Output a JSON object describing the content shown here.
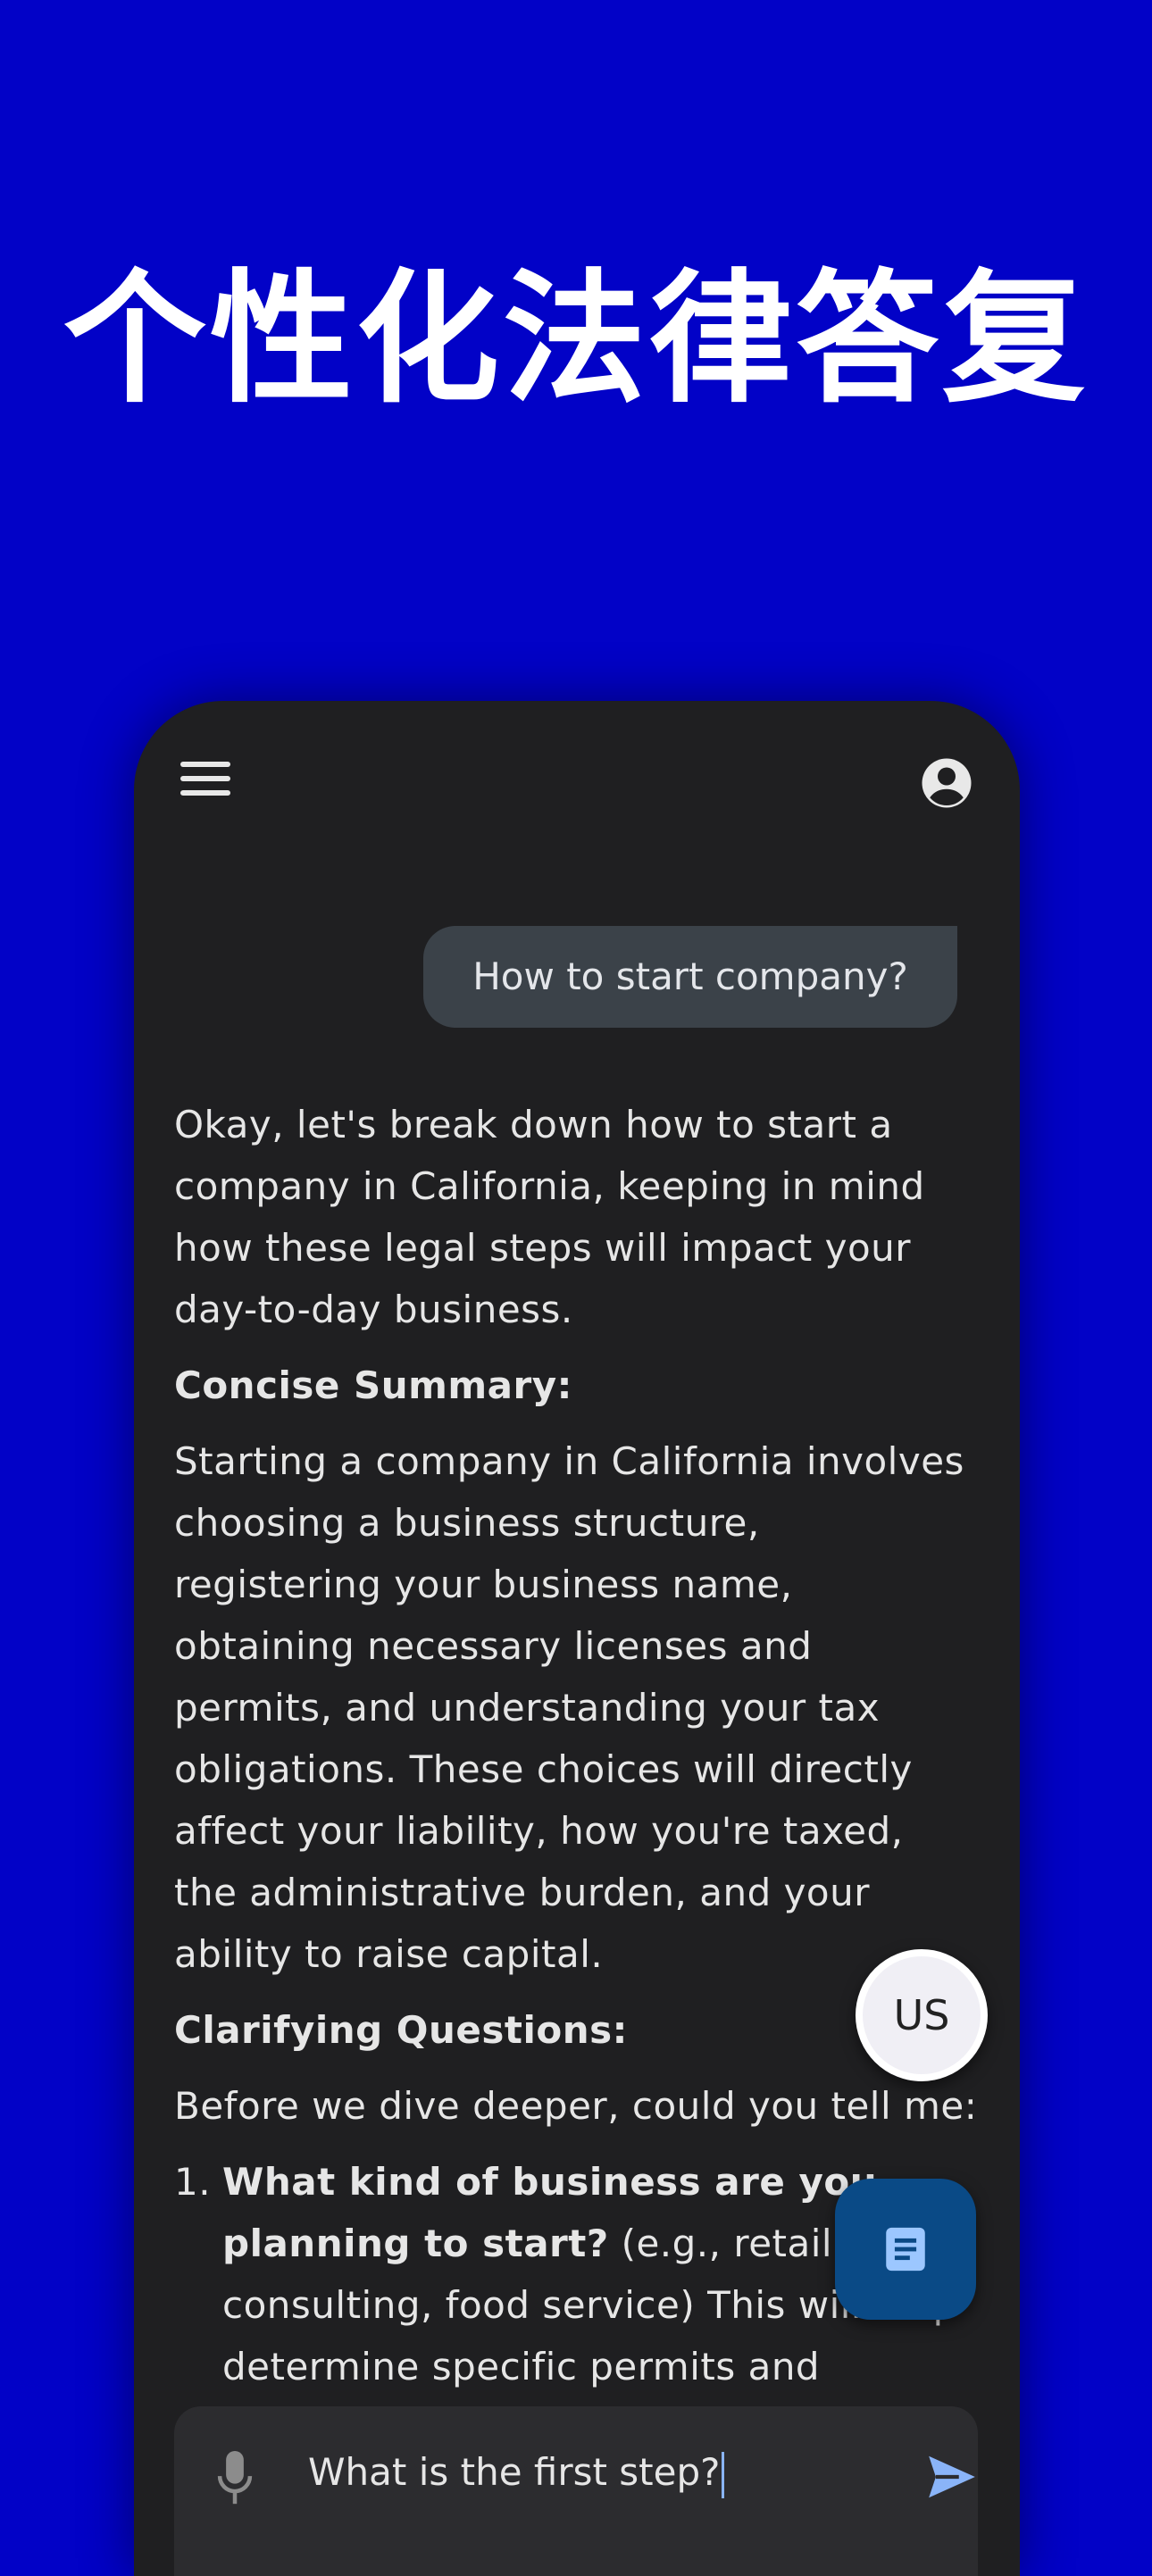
{
  "hero": {
    "title": "个性化法律答复"
  },
  "colors": {
    "background": "#0202c7",
    "phone": "#1f1f21",
    "bubble": "#3b4249",
    "fab": "#0a4a86"
  },
  "toolbar": {
    "menu_icon": "menu-icon",
    "account_icon": "account-icon"
  },
  "chat": {
    "user_message": "How to start company?",
    "reply": {
      "intro": "Okay, let's break down how to start a company in California, keeping in mind how these legal steps will impact your day-to-day business.",
      "summary_heading": "Concise Summary:",
      "summary": "Starting a company in California involves choosing a business structure, registering your business name, obtaining necessary licenses and permits, and understanding your tax obligations. These choices will directly affect your liability, how you're taxed, the administrative burden, and your ability to raise capital.",
      "questions_heading": "Clarifying Questions:",
      "questions_intro": "Before we dive deeper, could you tell me:",
      "questions": [
        {
          "number": "1.",
          "bold": "What kind of business are you planning to start?",
          "rest": " (e.g., retail, tech, consulting, food service) This will help determine specific permits and"
        }
      ]
    }
  },
  "fab_region": {
    "label": "US"
  },
  "fab_docs": {
    "icon": "document-icon"
  },
  "composer": {
    "value": "What is the first step?",
    "mic_icon": "mic-icon",
    "send_icon": "send-icon"
  }
}
